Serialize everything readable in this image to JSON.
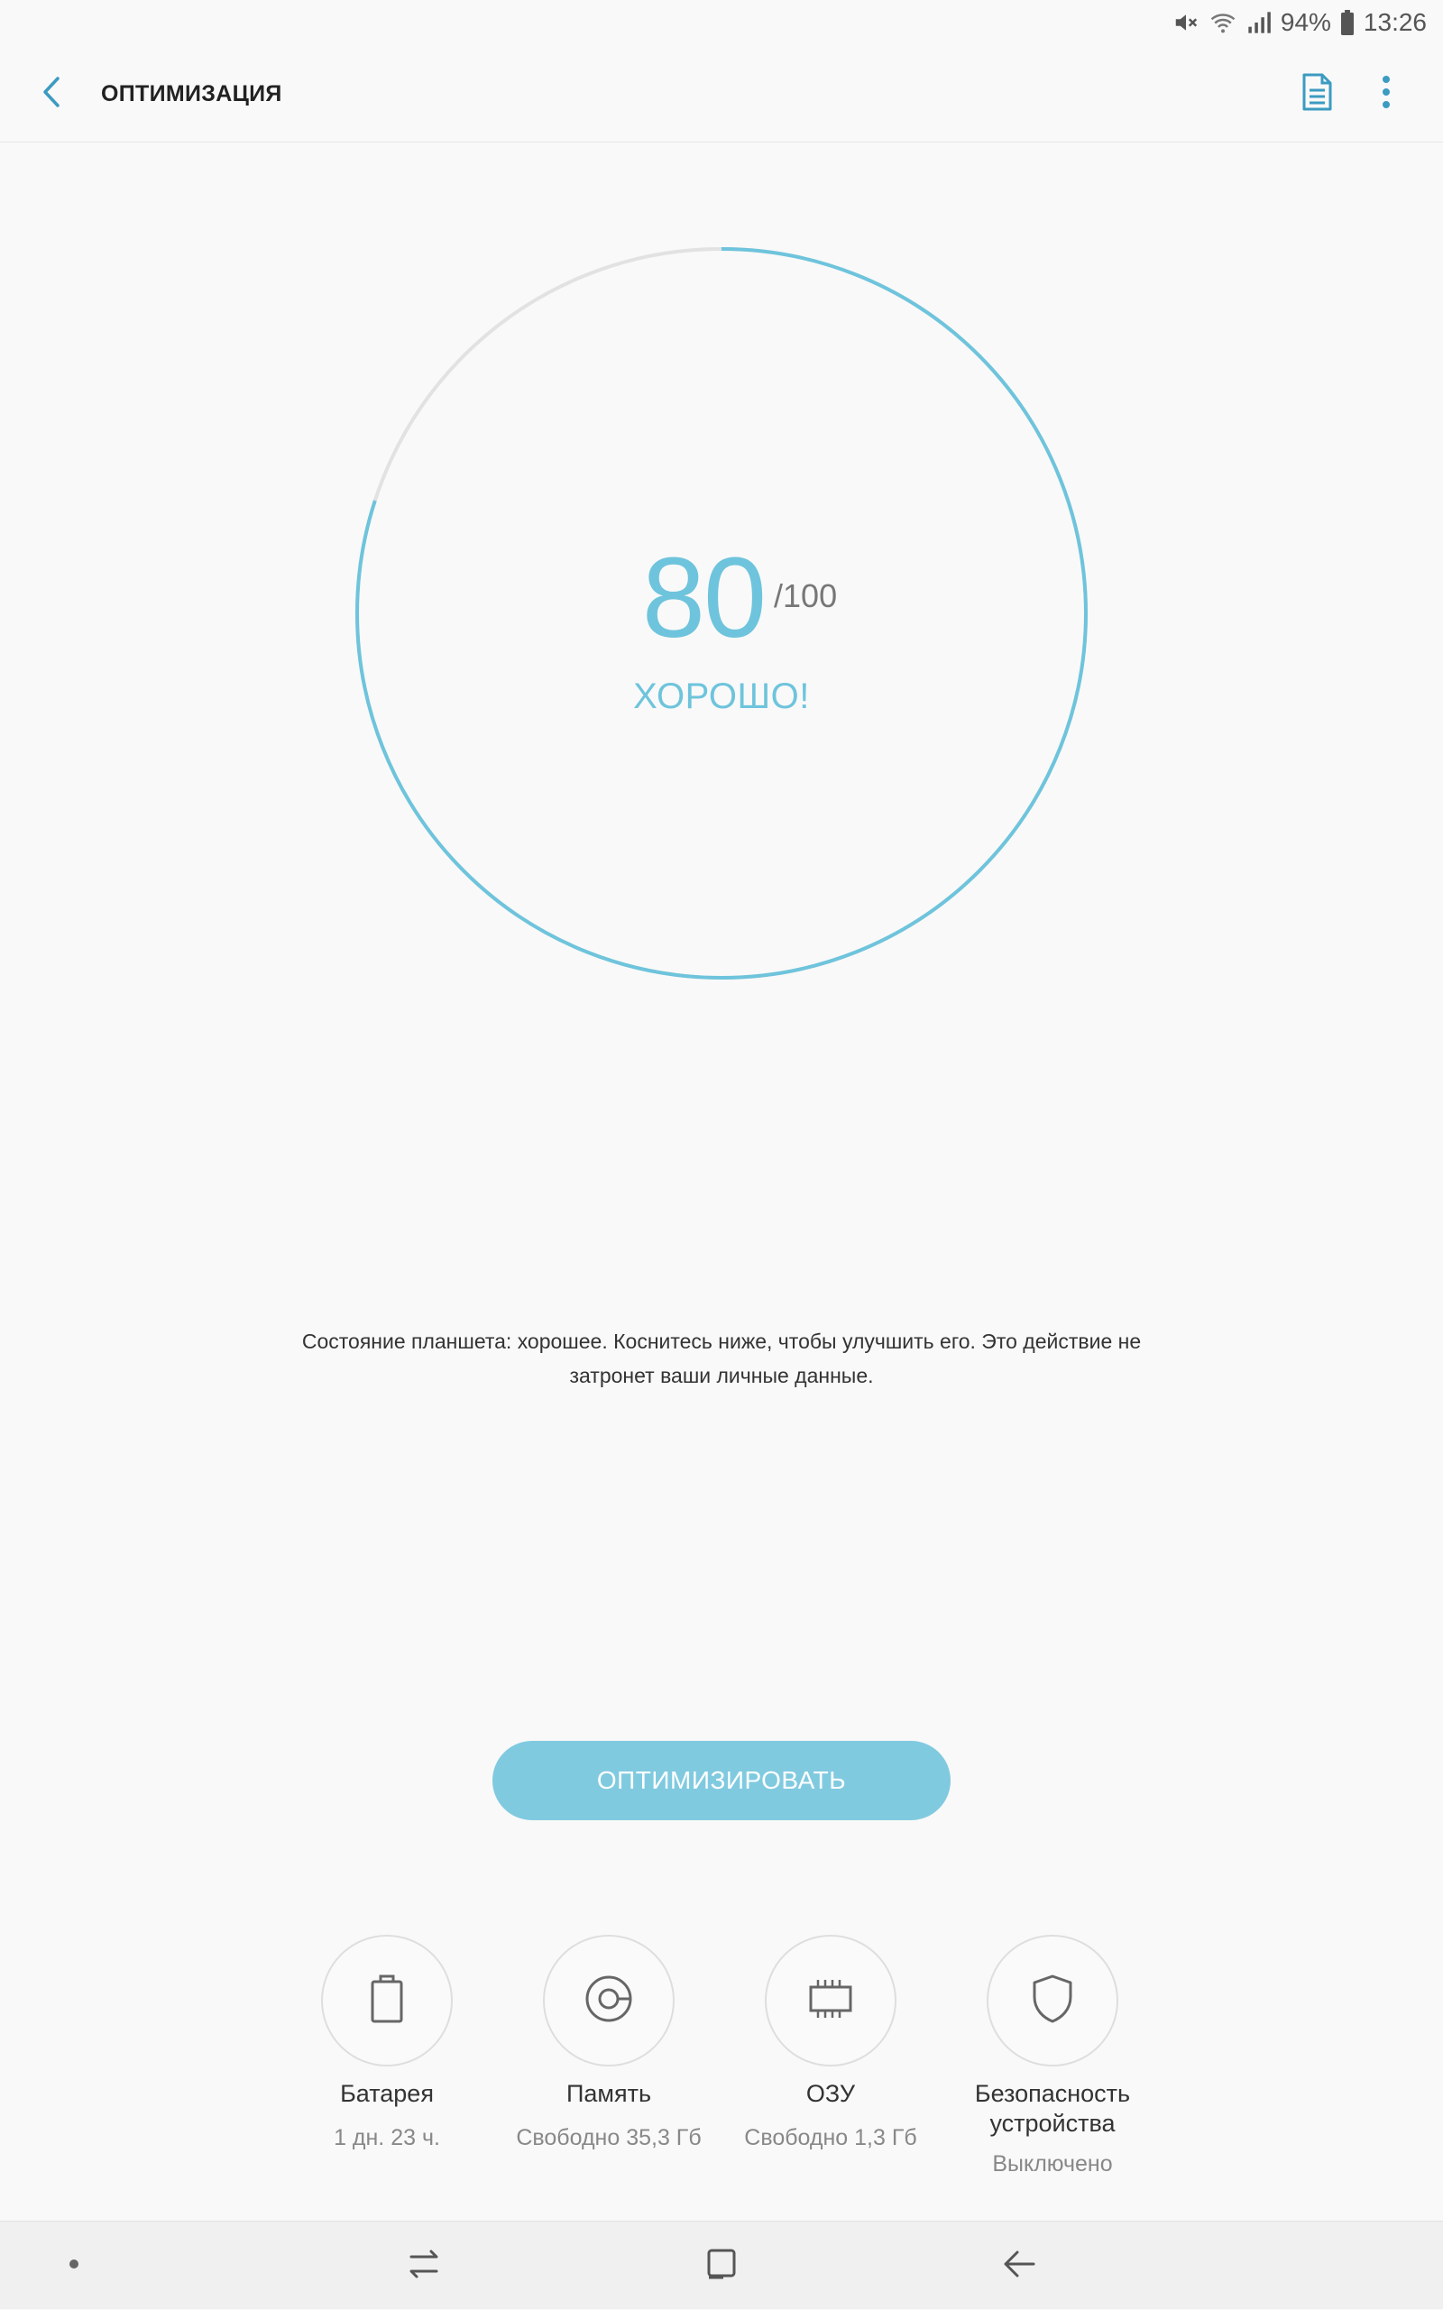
{
  "status_bar": {
    "battery_percent": "94%",
    "time": "13:26",
    "icons": [
      "mute-icon",
      "wifi-icon",
      "signal-icon",
      "battery-icon"
    ]
  },
  "header": {
    "title": "ОПТИМИЗАЦИЯ",
    "back_icon": "back-arrow-icon",
    "actions": [
      "report-icon",
      "more-options-icon"
    ]
  },
  "score": {
    "value": "80",
    "max": "/100",
    "status": "ХОРОШО!",
    "fill_fraction": 0.8,
    "color_accent": "#6ec4dc",
    "color_track": "#e2e2e2"
  },
  "description": "Состояние планшета: хорошее. Коснитесь ниже, чтобы улучшить его. Это действие не затронет ваши личные данные.",
  "optimize_button": {
    "label": "ОПТИМИЗИРОВАТЬ",
    "color": "#80cae0"
  },
  "tiles": [
    {
      "label": "Батарея",
      "sub": "1 дн. 23 ч.",
      "icon": "battery-icon"
    },
    {
      "label": "Память",
      "sub": "Свободно 35,3 Гб",
      "icon": "storage-icon"
    },
    {
      "label": "ОЗУ",
      "sub": "Свободно 1,3 Гб",
      "icon": "ram-chip-icon"
    },
    {
      "label": "Безопасность устройства",
      "sub": "Выключено",
      "icon": "shield-icon"
    }
  ],
  "nav_bar": [
    "dot-icon",
    "recent-apps-icon",
    "home-icon",
    "back-icon"
  ]
}
